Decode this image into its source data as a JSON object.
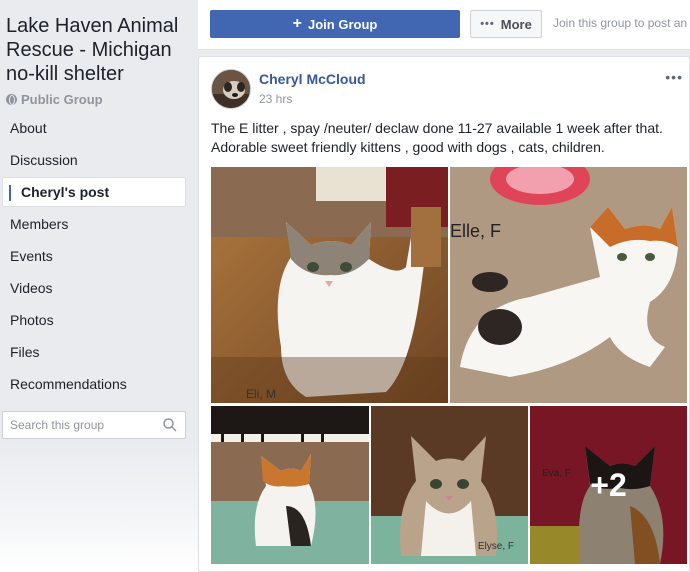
{
  "group": {
    "name": "Lake Haven Animal Rescue - Michigan no-kill shelter",
    "privacy": "Public Group"
  },
  "nav": {
    "items": [
      {
        "label": "About"
      },
      {
        "label": "Discussion"
      },
      {
        "label": "Cheryl's post",
        "active": true
      },
      {
        "label": "Members"
      },
      {
        "label": "Events"
      },
      {
        "label": "Videos"
      },
      {
        "label": "Photos"
      },
      {
        "label": "Files"
      },
      {
        "label": "Recommendations"
      }
    ]
  },
  "search": {
    "placeholder": "Search this group"
  },
  "actions": {
    "join_label": "Join Group",
    "more_label": "More",
    "join_hint": "Join this group to post an"
  },
  "post": {
    "author": "Cheryl McCloud",
    "time": "23 hrs",
    "text": "The E litter , spay /neuter/ declaw done 11-27 available 1 week after that. Adorable sweet friendly kittens , good with dogs , cats, children.",
    "photos": [
      {
        "caption": "Eli, M"
      },
      {
        "caption": "Elle, F"
      },
      {
        "caption": ""
      },
      {
        "caption": "Elyse, F"
      },
      {
        "caption": "Eva, F"
      }
    ],
    "more_count": "+2"
  },
  "colors": {
    "brand": "#4267b2",
    "link": "#365899",
    "background": "#e9ebee"
  }
}
